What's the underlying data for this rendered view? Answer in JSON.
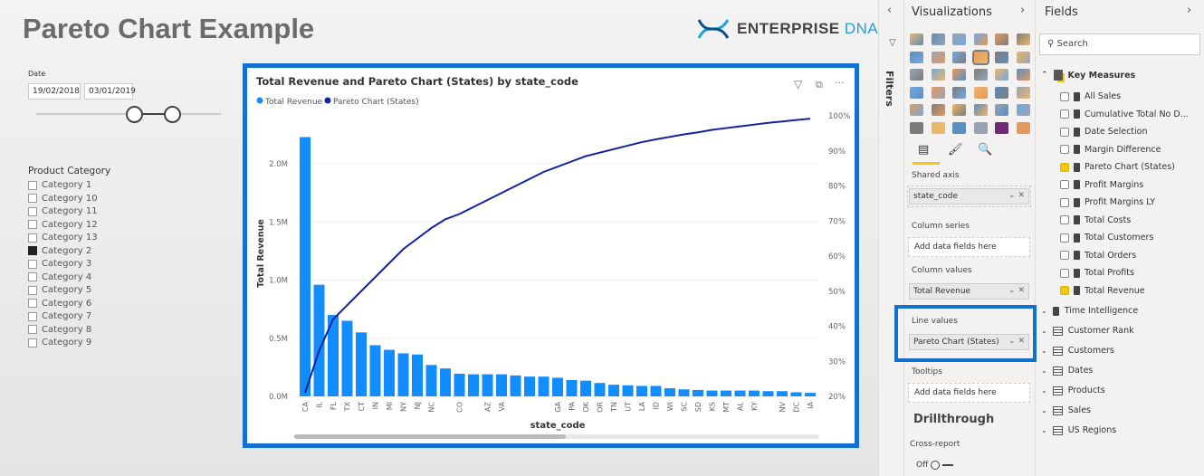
{
  "page_title": "Pareto Chart Example",
  "logo": {
    "text_main": "ENTERPRISE",
    "text_accent": "DNA"
  },
  "date_slicer": {
    "label": "Date",
    "start": "19/02/2018",
    "end": "03/01/2019"
  },
  "category_slicer": {
    "title": "Product Category",
    "items": [
      {
        "label": "Category 1",
        "checked": false
      },
      {
        "label": "Category 10",
        "checked": false
      },
      {
        "label": "Category 11",
        "checked": false
      },
      {
        "label": "Category 12",
        "checked": false
      },
      {
        "label": "Category 13",
        "checked": false
      },
      {
        "label": "Category 2",
        "checked": true
      },
      {
        "label": "Category 3",
        "checked": false
      },
      {
        "label": "Category 4",
        "checked": false
      },
      {
        "label": "Category 5",
        "checked": false
      },
      {
        "label": "Category 6",
        "checked": false
      },
      {
        "label": "Category 7",
        "checked": false
      },
      {
        "label": "Category 8",
        "checked": false
      },
      {
        "label": "Category 9",
        "checked": false
      }
    ]
  },
  "chart_data": {
    "type": "bar+line",
    "title": "Total Revenue and Pareto Chart (States) by state_code",
    "xlabel": "state_code",
    "ylabel": "Total Revenue",
    "categories": [
      "CA",
      "IL",
      "FL",
      "TX",
      "CT",
      "IN",
      "MI",
      "NY",
      "NJ",
      "NC",
      "",
      "CO",
      "",
      "AZ",
      "VA",
      "",
      "",
      "",
      "GA",
      "PA",
      "OK",
      "OR",
      "TN",
      "UT",
      "LA",
      "ID",
      "WI",
      "SC",
      "SD",
      "KS",
      "MT",
      "AL",
      "KY",
      "",
      "NV",
      "DC",
      "IA"
    ],
    "series": [
      {
        "name": "Total Revenue",
        "type": "bar",
        "axis": "left",
        "color": "#118dff",
        "values": [
          2.23,
          0.96,
          0.7,
          0.65,
          0.55,
          0.44,
          0.4,
          0.37,
          0.36,
          0.27,
          0.24,
          0.195,
          0.19,
          0.19,
          0.19,
          0.18,
          0.17,
          0.17,
          0.16,
          0.14,
          0.135,
          0.115,
          0.1,
          0.095,
          0.09,
          0.09,
          0.07,
          0.06,
          0.055,
          0.05,
          0.05,
          0.05,
          0.05,
          0.045,
          0.045,
          0.035,
          0.03
        ]
      },
      {
        "name": "Pareto Chart (States)",
        "type": "line",
        "axis": "right",
        "color": "#12239e",
        "values": [
          21,
          33,
          42,
          46,
          50,
          54,
          58,
          62,
          65,
          68,
          70.5,
          72,
          74,
          76,
          78,
          80,
          82,
          84,
          85.5,
          87,
          88.5,
          89.5,
          90.5,
          91.5,
          92.5,
          93.3,
          94,
          94.7,
          95.3,
          96,
          96.5,
          97,
          97.5,
          98,
          98.4,
          98.8,
          99.2
        ]
      }
    ],
    "y_left": {
      "range": [
        0,
        2.3
      ],
      "ticks": [
        "0.0M",
        "0.5M",
        "1.0M",
        "1.5M",
        "2.0M"
      ],
      "tick_values": [
        0,
        0.5,
        1,
        1.5,
        2
      ]
    },
    "y_right": {
      "range": [
        20,
        100
      ],
      "ticks": [
        "20%",
        "30%",
        "40%",
        "50%",
        "60%",
        "70%",
        "80%",
        "90%",
        "100%"
      ],
      "tick_values": [
        20,
        30,
        40,
        50,
        60,
        70,
        80,
        90,
        100
      ]
    },
    "legend": "top-left",
    "grid": true
  },
  "filters_label": "Filters",
  "visualizations": {
    "title": "Visualizations",
    "shared_axis": "Shared axis",
    "shared_axis_value": "state_code",
    "column_series": "Column series",
    "column_values": "Column values",
    "column_values_value": "Total Revenue",
    "line_values": "Line values",
    "line_values_value": "Pareto Chart (States)",
    "tooltips": "Tooltips",
    "add_fields": "Add data fields here",
    "drillthrough": "Drillthrough",
    "cross_report": "Cross-report",
    "toggle": "Off",
    "highlight_color": "#1170d0"
  },
  "fields": {
    "title": "Fields",
    "search_placeholder": "Search",
    "key_measures": "Key Measures",
    "measures": [
      {
        "label": "All Sales",
        "checked": false
      },
      {
        "label": "Cumulative Total No D...",
        "checked": false
      },
      {
        "label": "Date Selection",
        "checked": false
      },
      {
        "label": "Margin Difference",
        "checked": false
      },
      {
        "label": "Pareto Chart (States)",
        "checked": true
      },
      {
        "label": "Profit Margins",
        "checked": false
      },
      {
        "label": "Profit Margins LY",
        "checked": false
      },
      {
        "label": "Total Costs",
        "checked": false
      },
      {
        "label": "Total Customers",
        "checked": false
      },
      {
        "label": "Total Orders",
        "checked": false
      },
      {
        "label": "Total Profits",
        "checked": false
      },
      {
        "label": "Total Revenue",
        "checked": true
      }
    ],
    "tables": [
      "Time Intelligence",
      "Customer Rank",
      "Customers",
      "Dates",
      "Products",
      "Sales",
      "US Regions"
    ]
  }
}
